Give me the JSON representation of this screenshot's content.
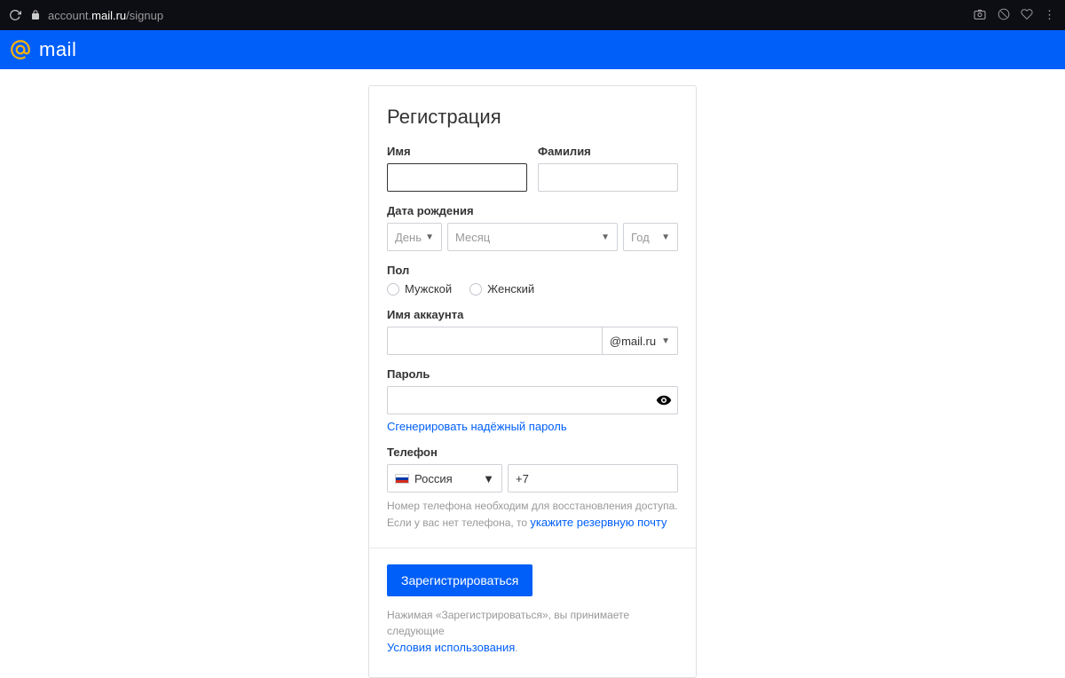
{
  "browser": {
    "url_account": "account.",
    "url_mailru": "mail.ru",
    "url_path": "/signup"
  },
  "header": {
    "logo_text": "mail"
  },
  "form": {
    "title": "Регистрация",
    "first_name_label": "Имя",
    "last_name_label": "Фамилия",
    "dob_label": "Дата рождения",
    "dob_day": "День",
    "dob_month": "Месяц",
    "dob_year": "Год",
    "gender_label": "Пол",
    "gender_male": "Мужской",
    "gender_female": "Женский",
    "account_label": "Имя аккаунта",
    "domain": "@mail.ru",
    "password_label": "Пароль",
    "gen_password": "Сгенерировать надёжный пароль",
    "phone_label": "Телефон",
    "country": "Россия",
    "phone_prefix": "+7",
    "phone_hint_1": "Номер телефона необходим для восстановления доступа.",
    "phone_hint_2_a": "Если у вас нет телефона, то ",
    "phone_hint_2_link": "укажите резервную почту",
    "submit": "Зарегистрироваться",
    "terms_a": "Нажимая «Зарегистрироваться», вы принимаете следующие ",
    "terms_link": "Условия использования"
  }
}
